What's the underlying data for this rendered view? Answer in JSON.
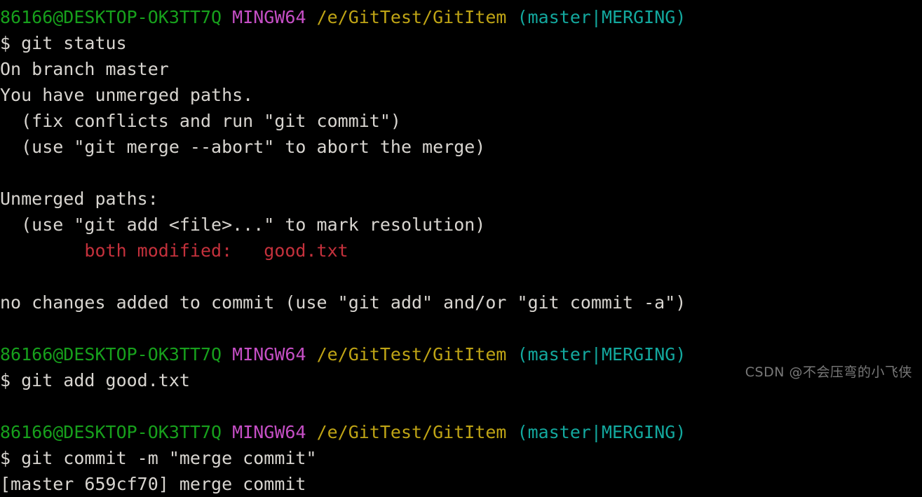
{
  "terminal": {
    "title": "MINGW64 /e/GitTest/GitItem",
    "background_color": "#000000",
    "colors": {
      "user": "#17a01c",
      "shell": "#c64fc6",
      "path": "#bfa415",
      "branch": "#13a89e",
      "text": "#d8d5d0",
      "conflict": "#c4313c",
      "watermark": "#8e8e8e"
    },
    "prompt": {
      "user_host": "86166@DESKTOP-OK3TT7Q",
      "shell": "MINGW64",
      "path": "/e/GitTest/GitItem",
      "branch": "(master|MERGING)",
      "symbol": "$"
    },
    "lines": [
      {
        "type": "prompt",
        "segments": [
          {
            "class": "c-user",
            "text": "86166@DESKTOP-OK3TT7Q"
          },
          {
            "class": "c-text",
            "text": " "
          },
          {
            "class": "c-shell",
            "text": "MINGW64"
          },
          {
            "class": "c-text",
            "text": " "
          },
          {
            "class": "c-path",
            "text": "/e/GitTest/GitItem"
          },
          {
            "class": "c-text",
            "text": " "
          },
          {
            "class": "c-branch",
            "text": "(master|MERGING)"
          }
        ]
      },
      {
        "type": "command",
        "segments": [
          {
            "class": "c-text",
            "text": "$ git status"
          }
        ]
      },
      {
        "type": "output",
        "segments": [
          {
            "class": "c-text",
            "text": "On branch master"
          }
        ]
      },
      {
        "type": "output",
        "segments": [
          {
            "class": "c-text",
            "text": "You have unmerged paths."
          }
        ]
      },
      {
        "type": "output",
        "segments": [
          {
            "class": "c-text",
            "text": "  (fix conflicts and run \"git commit\")"
          }
        ]
      },
      {
        "type": "output",
        "segments": [
          {
            "class": "c-text",
            "text": "  (use \"git merge --abort\" to abort the merge)"
          }
        ]
      },
      {
        "type": "blank",
        "segments": []
      },
      {
        "type": "output",
        "segments": [
          {
            "class": "c-text",
            "text": "Unmerged paths:"
          }
        ]
      },
      {
        "type": "output",
        "segments": [
          {
            "class": "c-text",
            "text": "  (use \"git add <file>...\" to mark resolution)"
          }
        ]
      },
      {
        "type": "output",
        "segments": [
          {
            "class": "c-red",
            "text": "        both modified:   good.txt"
          }
        ]
      },
      {
        "type": "blank",
        "segments": []
      },
      {
        "type": "output",
        "segments": [
          {
            "class": "c-text",
            "text": "no changes added to commit (use \"git add\" and/or \"git commit -a\")"
          }
        ]
      },
      {
        "type": "blank",
        "segments": []
      },
      {
        "type": "prompt",
        "segments": [
          {
            "class": "c-user",
            "text": "86166@DESKTOP-OK3TT7Q"
          },
          {
            "class": "c-text",
            "text": " "
          },
          {
            "class": "c-shell",
            "text": "MINGW64"
          },
          {
            "class": "c-text",
            "text": " "
          },
          {
            "class": "c-path",
            "text": "/e/GitTest/GitItem"
          },
          {
            "class": "c-text",
            "text": " "
          },
          {
            "class": "c-branch",
            "text": "(master|MERGING)"
          }
        ]
      },
      {
        "type": "command",
        "segments": [
          {
            "class": "c-text",
            "text": "$ git add good.txt"
          }
        ]
      },
      {
        "type": "blank",
        "segments": []
      },
      {
        "type": "prompt",
        "segments": [
          {
            "class": "c-user",
            "text": "86166@DESKTOP-OK3TT7Q"
          },
          {
            "class": "c-text",
            "text": " "
          },
          {
            "class": "c-shell",
            "text": "MINGW64"
          },
          {
            "class": "c-text",
            "text": " "
          },
          {
            "class": "c-path",
            "text": "/e/GitTest/GitItem"
          },
          {
            "class": "c-text",
            "text": " "
          },
          {
            "class": "c-branch",
            "text": "(master|MERGING)"
          }
        ]
      },
      {
        "type": "command",
        "segments": [
          {
            "class": "c-text",
            "text": "$ git commit -m \"merge commit\""
          }
        ]
      },
      {
        "type": "output",
        "segments": [
          {
            "class": "c-text",
            "text": "[master 659cf70] merge commit"
          }
        ]
      }
    ]
  },
  "watermark": {
    "text": "CSDN @不会压弯的小飞侠"
  }
}
